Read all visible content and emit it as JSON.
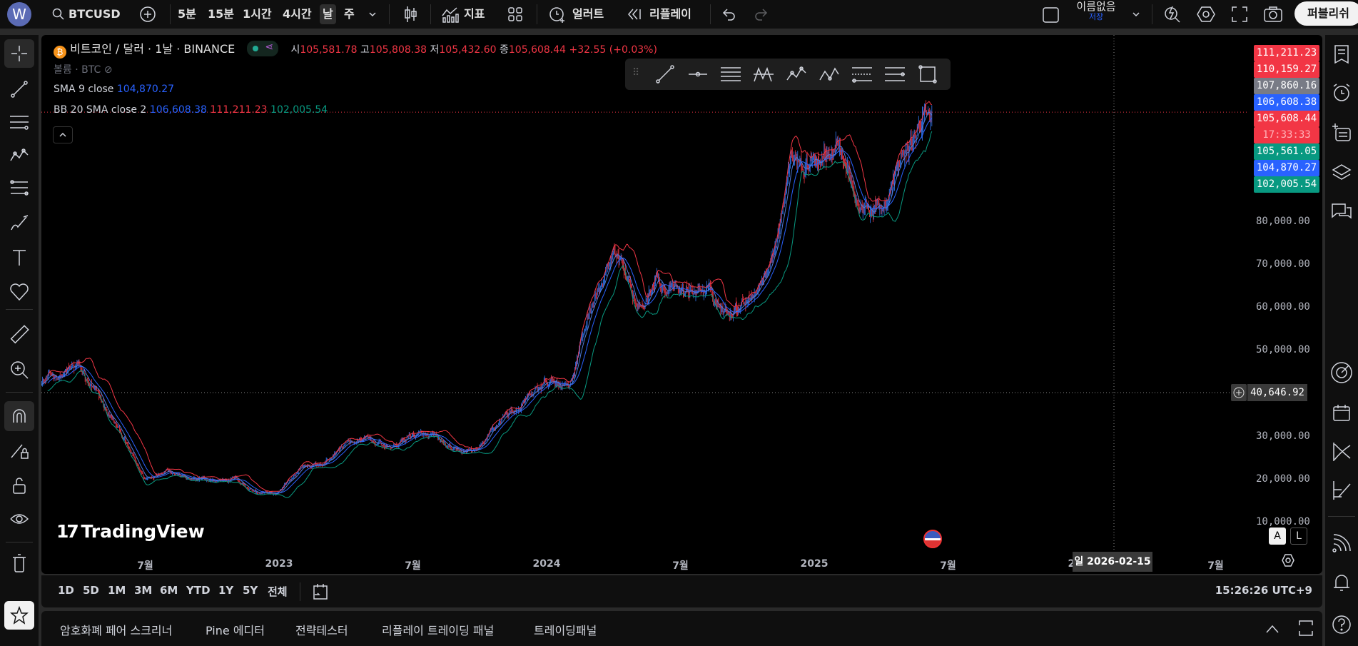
{
  "topbar": {
    "avatar": "W",
    "symbol": "BTCUSD",
    "intervals": [
      "5분",
      "15분",
      "1시간",
      "4시간",
      "날",
      "주"
    ],
    "selected_interval": "날",
    "indicators": "지표",
    "alert": "얼러트",
    "replay": "리플레이",
    "layout_name": "이름없음",
    "layout_status": "저장",
    "publish": "퍼블리쉬"
  },
  "legend": {
    "title": "비트코인 / 달러 · 1날 · BINANCE",
    "o_label": "시",
    "o": "105,581.78",
    "h_label": "고",
    "h": "105,808.38",
    "l_label": "저",
    "l": "105,432.60",
    "c_label": "종",
    "c": "105,608.44",
    "change": "+32.55 (+0.03%)",
    "volume": "볼륨 · BTC",
    "sma_label": "SMA 9 close",
    "sma_value": "104,870.27",
    "bb_label": "BB 20 SMA close 2",
    "bb_basis": "106,608.38",
    "bb_upper": "111,211.23",
    "bb_lower": "102,005.54"
  },
  "price_labels": [
    {
      "v": "111,211.23",
      "c": "#f23645"
    },
    {
      "v": "110,159.27",
      "c": "#f23645"
    },
    {
      "v": "107,860.16",
      "c": "#787b86"
    },
    {
      "v": "106,608.38",
      "c": "#2962ff"
    },
    {
      "v": "105,608.44",
      "c": "#f23645"
    },
    {
      "v": "17:33:33",
      "c": "#f23645"
    },
    {
      "v": "105,561.05",
      "c": "#089981"
    },
    {
      "v": "104,870.27",
      "c": "#2962ff"
    },
    {
      "v": "102,005.54",
      "c": "#089981"
    }
  ],
  "crosshair": {
    "price": "40,646.92",
    "date": "일 2026-02-15"
  },
  "time_axis": [
    "7월",
    "2023",
    "7월",
    "2024",
    "7월",
    "2025",
    "7월",
    "2026",
    "7월"
  ],
  "scale_buttons": {
    "auto": "A",
    "log": "L"
  },
  "logo": "TradingView",
  "range": [
    "1D",
    "5D",
    "1M",
    "3M",
    "6M",
    "YTD",
    "1Y",
    "5Y",
    "전체"
  ],
  "clock": "15:26:26 UTC+9",
  "bottom_tabs": [
    "암호화폐 페어 스크리너",
    "Pine 에디터",
    "전략테스터",
    "리플레이 트레이딩 패널",
    "트레이딩패널"
  ],
  "colors": {
    "up": "#3179f5",
    "down": "#f23645",
    "basis": "#2962ff",
    "upper": "#f23645",
    "lower": "#089981"
  },
  "chart_data": {
    "type": "candlestick",
    "title": "BTCUSD 1D BINANCE",
    "ylim": [
      10000,
      115000
    ],
    "y_ticks": [
      "80,000.00",
      "70,000.00",
      "60,000.00",
      "50,000.00",
      "30,000.00",
      "20,000.00",
      "10,000.00"
    ],
    "y_tick_values": [
      80000,
      70000,
      60000,
      50000,
      30000,
      20000,
      10000
    ],
    "months": [
      "2022-02",
      "2022-03",
      "2022-04",
      "2022-05",
      "2022-06",
      "2022-07",
      "2022-08",
      "2022-09",
      "2022-10",
      "2022-11",
      "2022-12",
      "2023-01",
      "2023-02",
      "2023-03",
      "2023-04",
      "2023-05",
      "2023-06",
      "2023-07",
      "2023-08",
      "2023-09",
      "2023-10",
      "2023-11",
      "2023-12",
      "2024-01",
      "2024-02",
      "2024-03",
      "2024-04",
      "2024-05",
      "2024-06",
      "2024-07",
      "2024-08",
      "2024-09",
      "2024-10",
      "2024-11",
      "2024-12",
      "2025-01",
      "2025-02",
      "2025-03",
      "2025-04",
      "2025-05",
      "2025-06"
    ],
    "approx_price": [
      42000,
      44000,
      46000,
      38000,
      30000,
      20000,
      23000,
      20000,
      19400,
      20500,
      17000,
      16600,
      23100,
      23500,
      28500,
      29200,
      27200,
      30500,
      29200,
      26000,
      27000,
      34600,
      37700,
      42300,
      42600,
      61200,
      71300,
      60600,
      67500,
      62700,
      64600,
      59000,
      63300,
      70300,
      96400,
      93400,
      102400,
      84300,
      82500,
      94200,
      104600
    ],
    "last": 105608.44
  }
}
